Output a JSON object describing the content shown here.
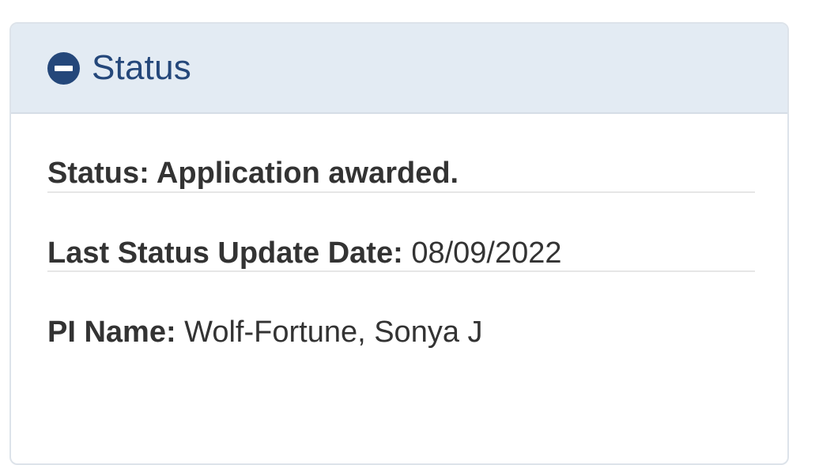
{
  "panel": {
    "title": "Status",
    "collapse_icon": "minus-circle-icon"
  },
  "fields": {
    "status": "Status: Application awarded.",
    "last_update_label": "Last Status Update Date:",
    "last_update_value": "08/09/2022",
    "pi_label": "PI Name:",
    "pi_value": "Wolf-Fortune, Sonya J"
  },
  "colors": {
    "header_bg": "#e3ebf3",
    "accent": "#24477a",
    "text": "#333333"
  }
}
